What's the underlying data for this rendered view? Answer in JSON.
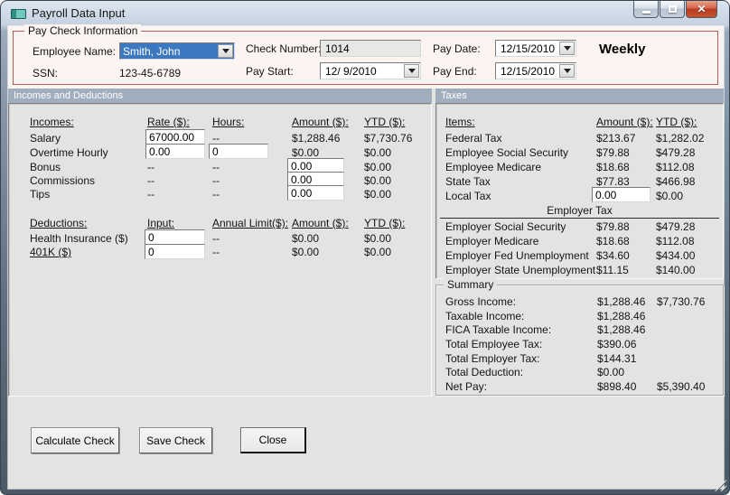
{
  "window": {
    "title": "Payroll Data Input"
  },
  "colors": {
    "pay_group_border": "#b55b55",
    "pay_band_background": "#fcf4f0",
    "section_header_background": "#a1aebe",
    "combobox_selection_blue": "#3b78bf",
    "close_button_red": "#b93a22",
    "client_background": "#e3e3e1"
  },
  "paycheck": {
    "group_label": "Pay Check Information",
    "employee_name_label": "Employee Name:",
    "employee_name_value": "Smith, John",
    "ssn_label": "SSN:",
    "ssn_value": "123-45-6789",
    "check_number_label": "Check Number:",
    "check_number_value": "1014",
    "pay_start_label": "Pay Start:",
    "pay_start_value": "12/ 9/2010",
    "pay_date_label": "Pay Date:",
    "pay_date_value": "12/15/2010",
    "pay_end_label": "Pay End:",
    "pay_end_value": "12/15/2010",
    "frequency": "Weekly"
  },
  "incomes_section": {
    "title": "Incomes and Deductions",
    "headers": {
      "item": "Incomes:",
      "rate": "Rate ($):",
      "hours": "Hours:",
      "amount": "Amount ($):",
      "ytd": "YTD ($):"
    },
    "rows": [
      {
        "label": "Salary",
        "rate": "67000.00",
        "hours": "--",
        "amount": "$1,288.46",
        "ytd": "$7,730.76"
      },
      {
        "label": "Overtime Hourly",
        "rate": "0.00",
        "hours": "0",
        "amount": "$0.00",
        "ytd": "$0.00"
      },
      {
        "label": "Bonus",
        "rate": "--",
        "hours": "--",
        "amount": "0.00",
        "ytd": "$0.00"
      },
      {
        "label": "Commissions",
        "rate": "--",
        "hours": "--",
        "amount": "0.00",
        "ytd": "$0.00"
      },
      {
        "label": "Tips",
        "rate": "--",
        "hours": "--",
        "amount": "0.00",
        "ytd": "$0.00"
      }
    ],
    "deduction_headers": {
      "item": "Deductions:",
      "input": "Input:",
      "limit": "Annual Limit($):",
      "amount": "Amount ($):",
      "ytd": "YTD ($):"
    },
    "deduction_rows": [
      {
        "label": "Health Insurance  ($)",
        "input": "0",
        "limit": "--",
        "amount": "$0.00",
        "ytd": "$0.00"
      },
      {
        "label": "401K  ($)",
        "input": "0",
        "limit": "--",
        "amount": "$0.00",
        "ytd": "$0.00"
      }
    ]
  },
  "taxes_section": {
    "title": "Taxes",
    "headers": {
      "item": "Items:",
      "amount": "Amount ($):",
      "ytd": "YTD ($):"
    },
    "employee_rows": [
      {
        "label": "Federal Tax",
        "amount": "$213.67",
        "ytd": "$1,282.02"
      },
      {
        "label": "Employee Social Security",
        "amount": "$79.88",
        "ytd": "$479.28"
      },
      {
        "label": "Employee Medicare",
        "amount": "$18.68",
        "ytd": "$112.08"
      },
      {
        "label": "State Tax",
        "amount": "$77.83",
        "ytd": "$466.98"
      },
      {
        "label": "Local Tax",
        "amount": "0.00",
        "ytd": "$0.00"
      }
    ],
    "employer_group_label": "Employer Tax",
    "employer_rows": [
      {
        "label": "Employer Social Security",
        "amount": "$79.88",
        "ytd": "$479.28"
      },
      {
        "label": "Employer Medicare",
        "amount": "$18.68",
        "ytd": "$112.08"
      },
      {
        "label": "Employer Fed Unemployment",
        "amount": "$34.60",
        "ytd": "$434.00"
      },
      {
        "label": "Employer State Unemployment",
        "amount": "$11.15",
        "ytd": "$140.00"
      }
    ]
  },
  "summary": {
    "group_label": "Summary",
    "rows": [
      {
        "label": "Gross Income:",
        "amount": "$1,288.46",
        "ytd": "$7,730.76"
      },
      {
        "label": "Taxable Income:",
        "amount": "$1,288.46",
        "ytd": ""
      },
      {
        "label": "FICA Taxable Income:",
        "amount": "$1,288.46",
        "ytd": ""
      },
      {
        "label": "Total Employee Tax:",
        "amount": "$390.06",
        "ytd": ""
      },
      {
        "label": "Total Employer Tax:",
        "amount": "$144.31",
        "ytd": ""
      },
      {
        "label": "Total Deduction:",
        "amount": "$0.00",
        "ytd": ""
      },
      {
        "label": "Net Pay:",
        "amount": "$898.40",
        "ytd": "$5,390.40"
      }
    ]
  },
  "buttons": {
    "calculate": "Calculate Check",
    "save": "Save Check",
    "close": "Close"
  }
}
